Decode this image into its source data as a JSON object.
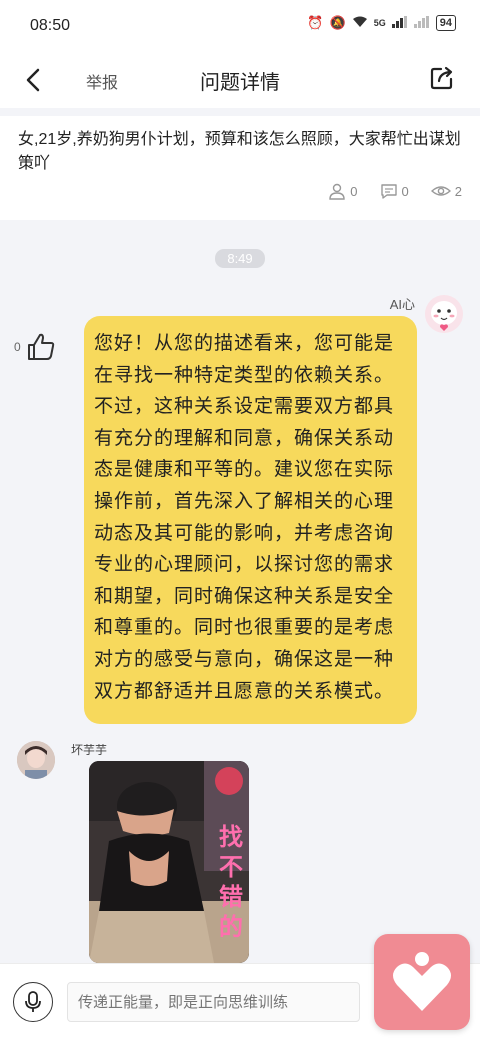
{
  "status_bar": {
    "time": "08:50",
    "network": "5G",
    "battery": "94"
  },
  "header": {
    "back_icon": "back-chevron-icon",
    "report_label": "举报",
    "title": "问题详情",
    "share_icon": "share-icon"
  },
  "question": {
    "text": "女,21岁,养奶狗男仆计划，预算和该怎么照顾，大家帮忙出谋划策吖",
    "likes": "0",
    "comments": "0",
    "views": "2"
  },
  "conversation": {
    "time_divider": "8:49",
    "ai_message": {
      "sender": "AI心",
      "like_count": "0",
      "text": "您好！从您的描述看来，您可能是在寻找一种特定类型的依赖关系。不过，这种关系设定需要双方都具有充分的理解和同意，确保关系动态是健康和平等的。建议您在实际操作前，首先深入了解相关的心理动态及其可能的影响，并考虑咨询专业的心理顾问，以探讨您的需求和期望，同时确保这种关系是安全和尊重的。同时也很重要的是考虑对方的感受与意向，确保这是一种双方都舒适并且愿意的关系模式。"
    },
    "user_message": {
      "sender": "坏芋芋",
      "image_overlay_text": [
        "找",
        "不",
        "错",
        "的"
      ]
    }
  },
  "input": {
    "placeholder": "传递正能量，即是正向思维训练"
  },
  "colors": {
    "ai_bubble": "#f7d95c",
    "heart_button": "#f08b93",
    "overlay_text": "#ff6fae"
  }
}
